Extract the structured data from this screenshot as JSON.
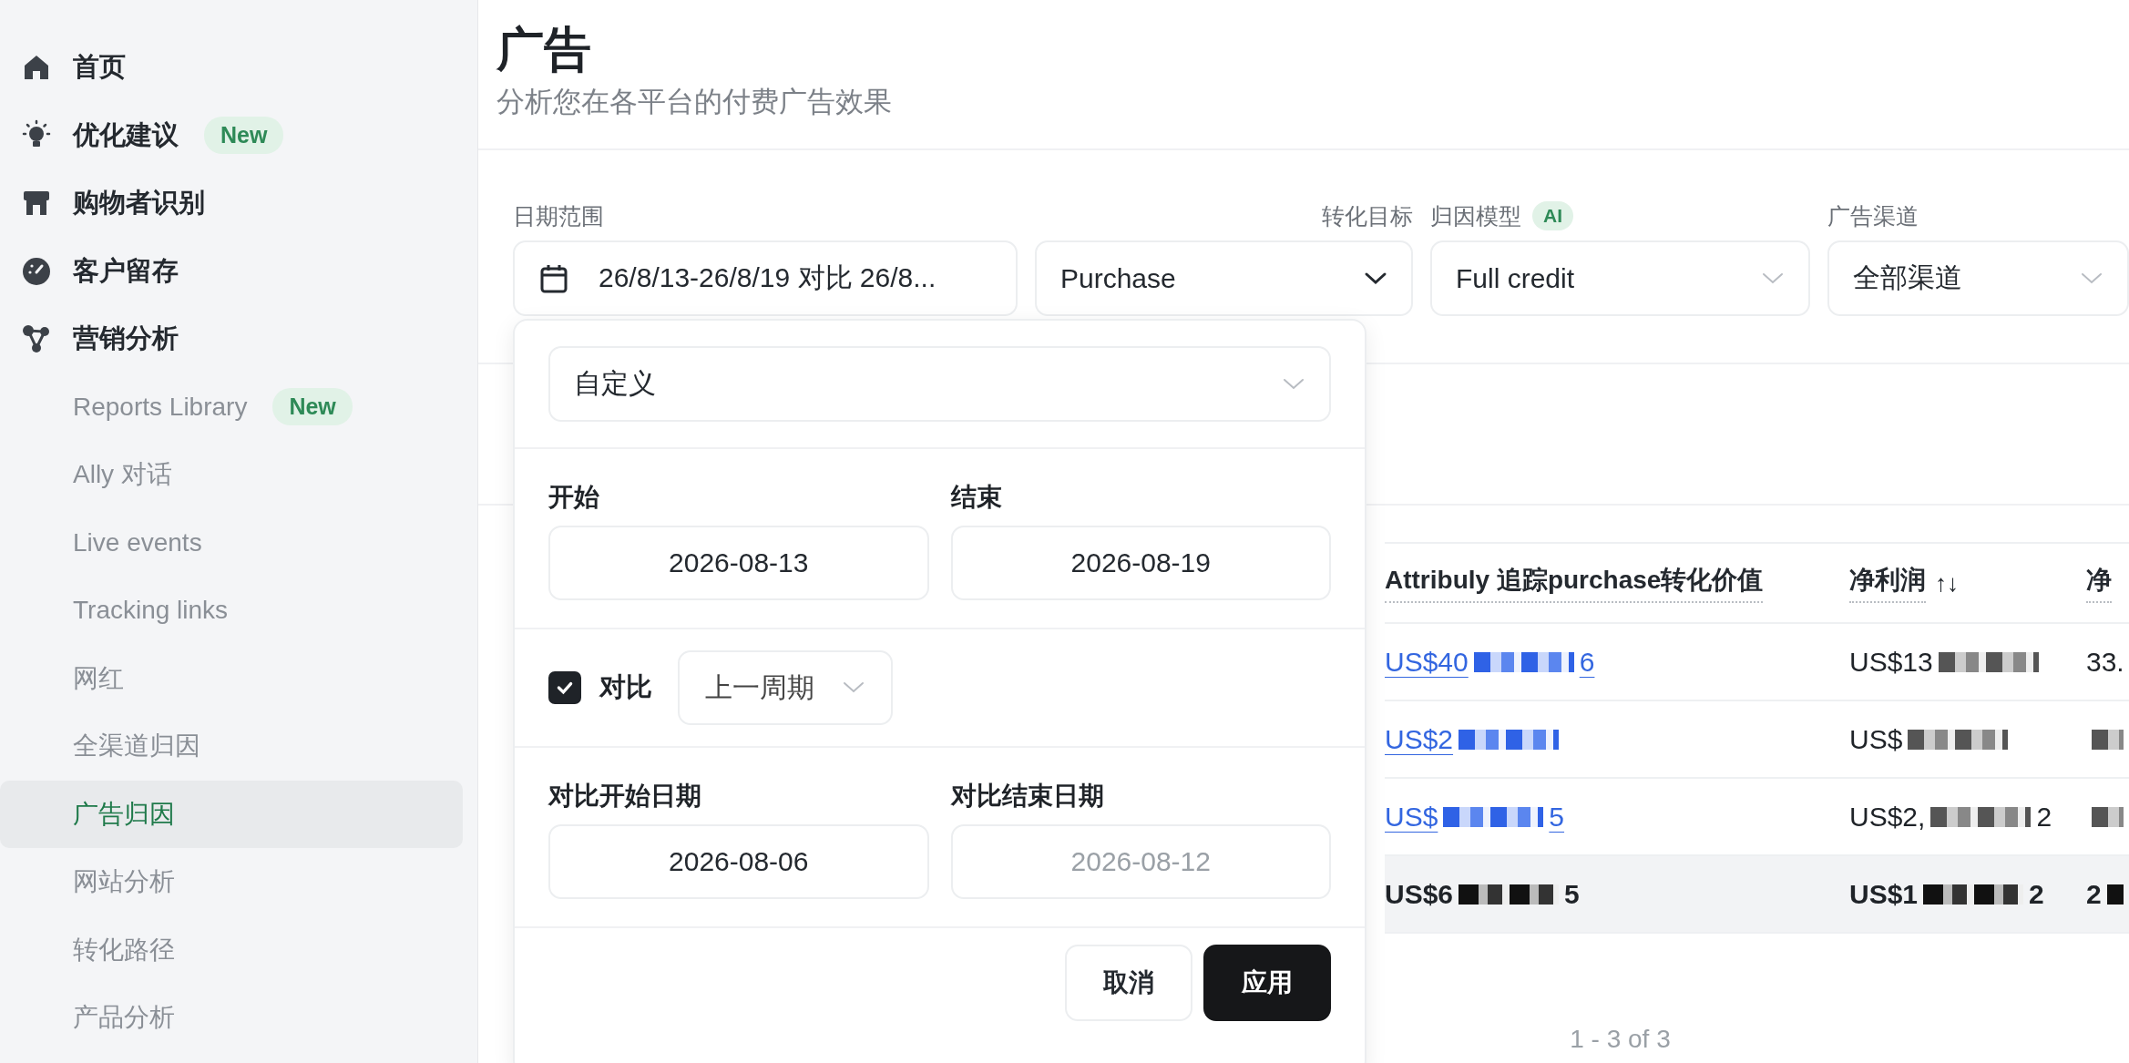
{
  "sidebar": {
    "items": [
      {
        "label": "首页",
        "selected": false
      },
      {
        "label": "优化建议",
        "badge": "New",
        "selected": false
      },
      {
        "label": "购物者识别",
        "selected": false
      },
      {
        "label": "客户留存",
        "selected": false
      },
      {
        "label": "营销分析",
        "selected": false,
        "children": [
          {
            "label": "Reports Library",
            "badge": "New",
            "selected": false
          },
          {
            "label": "Ally 对话",
            "selected": false
          },
          {
            "label": "Live events",
            "selected": false
          },
          {
            "label": "Tracking links",
            "selected": false
          },
          {
            "label": "网红",
            "selected": false
          },
          {
            "label": "全渠道归因",
            "selected": false
          },
          {
            "label": "广告归因",
            "selected": true
          },
          {
            "label": "网站分析",
            "selected": false
          },
          {
            "label": "转化路径",
            "selected": false
          },
          {
            "label": "产品分析",
            "selected": false
          }
        ]
      }
    ]
  },
  "header": {
    "title": "广告",
    "subtitle": "分析您在各平台的付费广告效果"
  },
  "filters": [
    {
      "kind": "date",
      "label": "日期范围",
      "value": "26/8/13-26/8/19 对比 26/8..."
    },
    {
      "kind": "select",
      "label": "转化目标",
      "value": "Purchase"
    },
    {
      "kind": "select",
      "label": "归因模型",
      "badge": "AI",
      "value": "Full credit"
    },
    {
      "kind": "select",
      "label": "广告渠道",
      "value": "全部渠道"
    }
  ],
  "date_popup": {
    "preset": "自定义",
    "start": {
      "label": "开始",
      "value": "2026-08-13",
      "disabled": false
    },
    "end": {
      "label": "结束",
      "value": "2026-08-19",
      "disabled": false
    },
    "compare": {
      "label": "对比",
      "checked": true,
      "option": "上一周期"
    },
    "compare_start": {
      "label": "对比开始日期",
      "value": "2026-08-06",
      "disabled": false
    },
    "compare_end": {
      "label": "对比结束日期",
      "value": "2026-08-12",
      "disabled": true
    },
    "buttons": [
      {
        "label": "取消",
        "kind": "secondary"
      },
      {
        "label": "应用",
        "kind": "primary"
      }
    ]
  },
  "table": {
    "columns": [
      {
        "label": "Attribuly 追踪purchase转化价值"
      },
      {
        "label": "净利润",
        "sort": "↑↓"
      },
      {
        "label": "净"
      }
    ],
    "rows": [
      {
        "total": false,
        "cells": [
          {
            "link": true,
            "parts": [
              {
                "text": "US$40"
              },
              {
                "kind": "redacted"
              },
              {
                "text": "6"
              }
            ]
          },
          {
            "link": false,
            "parts": [
              {
                "text": "US$13"
              },
              {
                "kind": "redacted"
              }
            ]
          },
          {
            "link": false,
            "parts": [
              {
                "text": "33."
              }
            ]
          }
        ]
      },
      {
        "total": false,
        "cells": [
          {
            "link": true,
            "parts": [
              {
                "text": "US$2"
              },
              {
                "kind": "redacted"
              }
            ]
          },
          {
            "link": false,
            "parts": [
              {
                "text": "US$"
              },
              {
                "kind": "redacted"
              }
            ]
          },
          {
            "link": false,
            "parts": [
              {
                "kind": "redacted"
              }
            ]
          }
        ]
      },
      {
        "total": false,
        "cells": [
          {
            "link": true,
            "parts": [
              {
                "text": "US$"
              },
              {
                "kind": "redacted"
              },
              {
                "text": "5"
              }
            ]
          },
          {
            "link": false,
            "parts": [
              {
                "text": "US$2,"
              },
              {
                "kind": "redacted"
              },
              {
                "text": "2"
              }
            ]
          },
          {
            "link": false,
            "parts": [
              {
                "kind": "redacted"
              }
            ]
          }
        ]
      },
      {
        "total": true,
        "cells": [
          {
            "link": false,
            "parts": [
              {
                "text": "US$6"
              },
              {
                "kind": "redacted"
              },
              {
                "text": "5"
              }
            ]
          },
          {
            "link": false,
            "parts": [
              {
                "text": "US$1"
              },
              {
                "kind": "redacted"
              },
              {
                "text": "2"
              }
            ]
          },
          {
            "link": false,
            "parts": [
              {
                "text": "2"
              },
              {
                "kind": "redacted"
              }
            ]
          }
        ]
      }
    ],
    "pagination": "1 - 3 of 3"
  }
}
